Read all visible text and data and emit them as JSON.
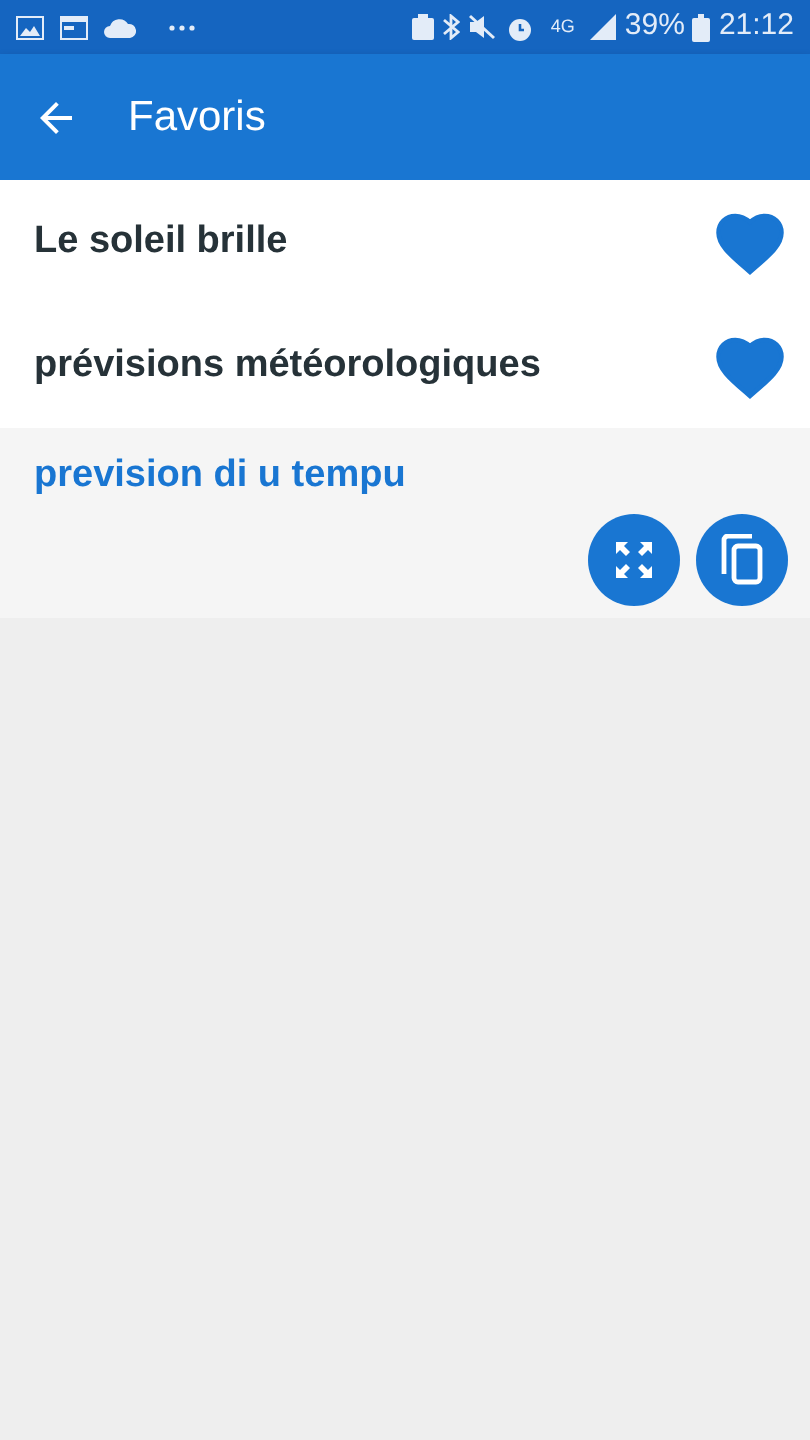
{
  "status_bar": {
    "network": "4G",
    "battery": "39%",
    "time": "21:12"
  },
  "app_bar": {
    "title": "Favoris"
  },
  "favorites": [
    {
      "text": "Le soleil brille",
      "favorite": true
    },
    {
      "text": "prévisions météorologiques",
      "favorite": true
    }
  ],
  "translation": {
    "text": "prevision di u tempu"
  }
}
